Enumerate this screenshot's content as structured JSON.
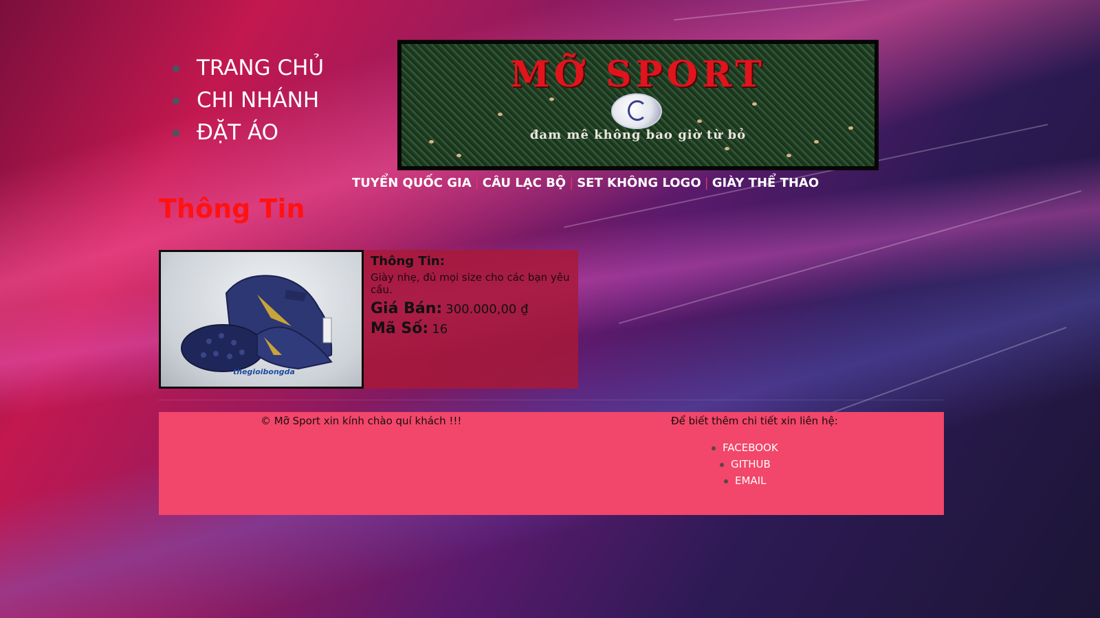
{
  "side_nav": {
    "items": [
      {
        "label": "TRANG CHỦ"
      },
      {
        "label": "CHI NHÁNH"
      },
      {
        "label": "ĐẶT ÁO"
      }
    ]
  },
  "banner": {
    "title": "MỠ SPORT",
    "slogan": "đam mê không bao giờ từ bỏ"
  },
  "category_nav": {
    "items": [
      {
        "label": "TUYỂN QUỐC GIA"
      },
      {
        "label": "CÂU LẠC BỘ"
      },
      {
        "label": "SET KHÔNG LOGO"
      },
      {
        "label": "GIÀY THỂ THAO"
      }
    ],
    "separator": "|"
  },
  "section": {
    "title": "Thông Tin"
  },
  "product": {
    "image_brand_text": "thegioibongda",
    "info_heading": "Thông Tin:",
    "description": "Giày nhẹ, đủ mọi size cho các bạn yêu cầu.",
    "price_label": "Giá Bán:",
    "price_value": "300.000,00 ₫",
    "code_label": "Mã Số:",
    "code_value": "16"
  },
  "footer": {
    "greeting": "© Mỡ Sport xin kính chào quí khách !!!",
    "contact_heading": "Để biết thêm chi tiết xin liên hệ:",
    "links": [
      {
        "label": "FACEBOOK"
      },
      {
        "label": "GITHUB"
      },
      {
        "label": "EMAIL"
      }
    ]
  },
  "colors": {
    "title_red": "#ff1212",
    "footer_bg": "#f2466a",
    "info_bg": "#aa1937"
  }
}
